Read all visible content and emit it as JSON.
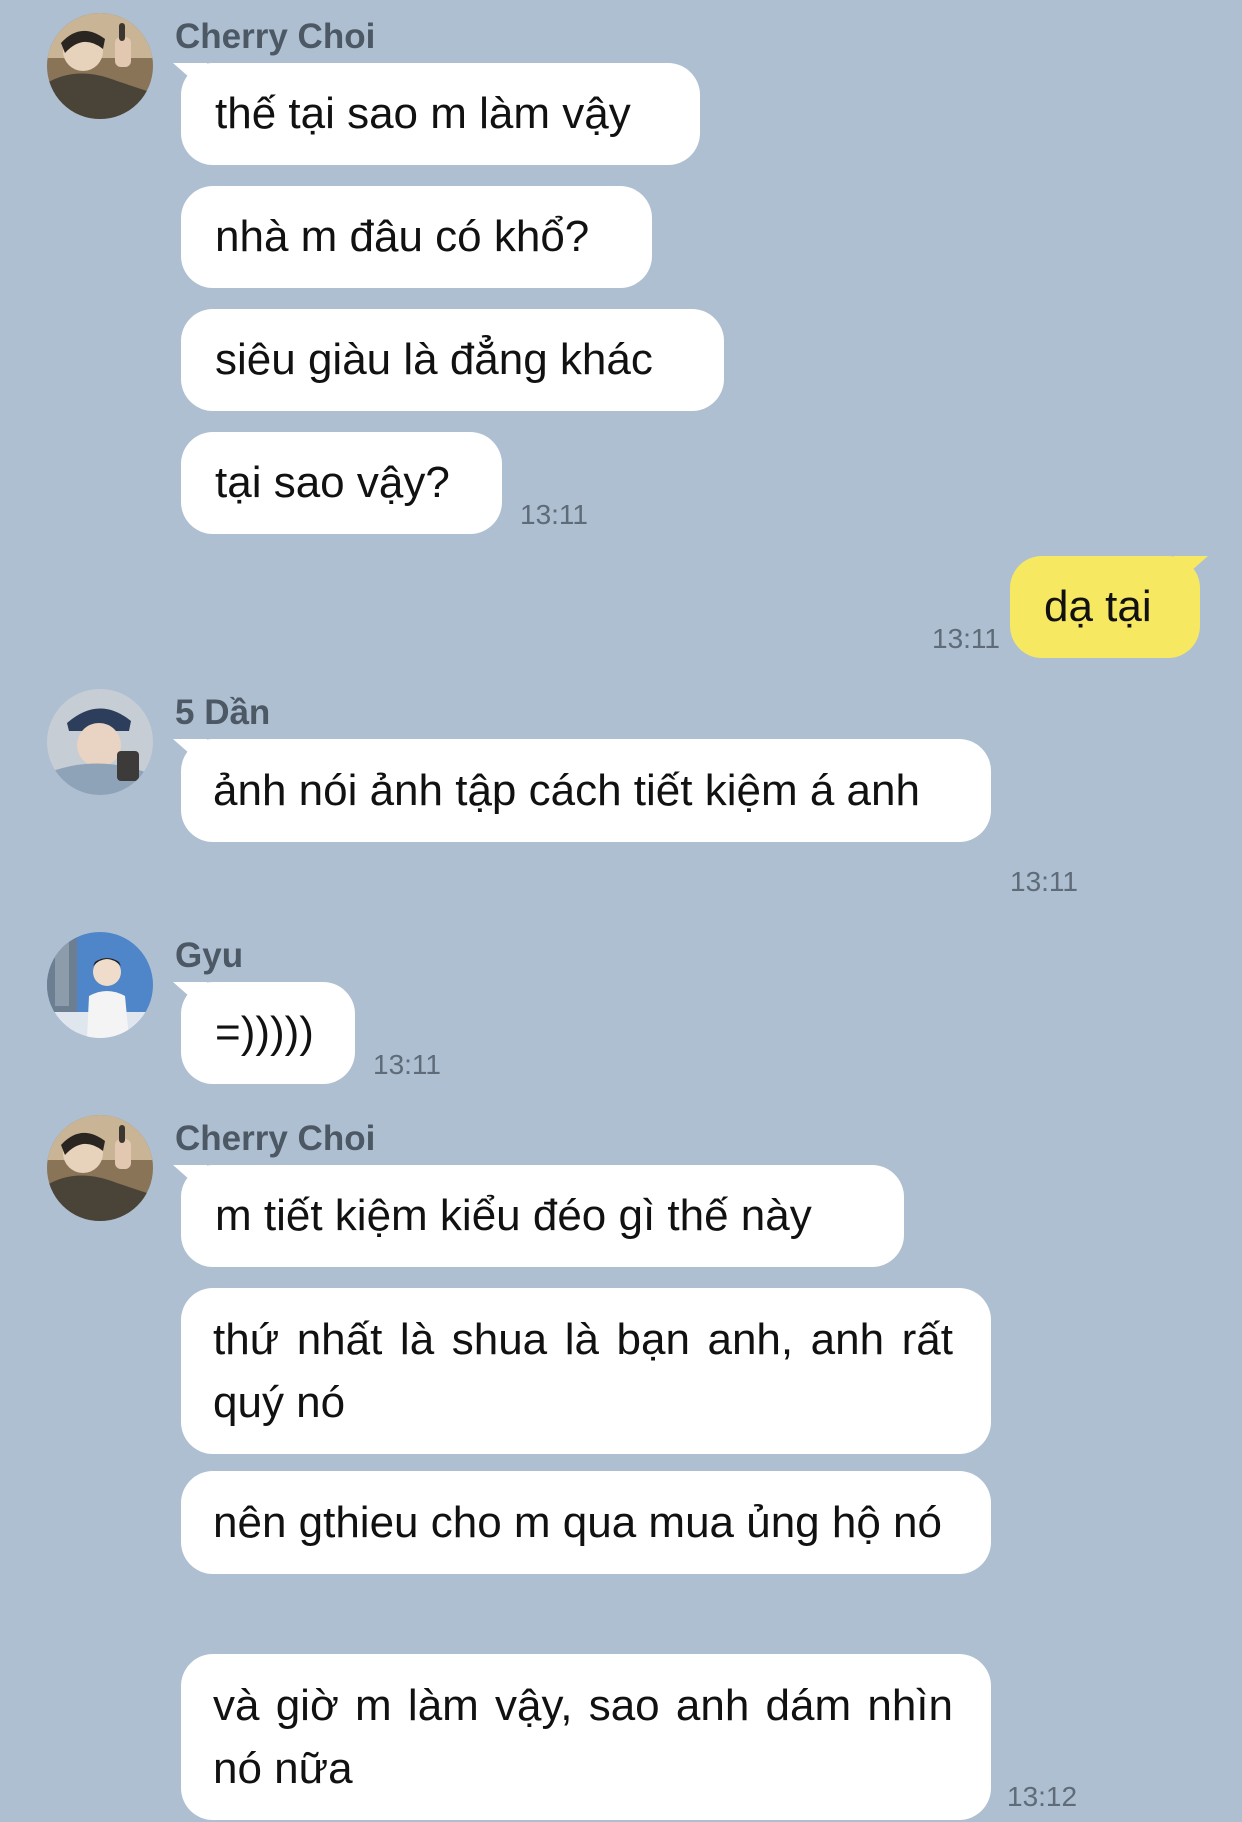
{
  "messages": [
    {
      "sender": "Cherry Choi",
      "lines": [
        "thế tại sao m làm vậy",
        "nhà m đâu có khổ?",
        "siêu giàu là đẳng khác",
        "tại sao vậy?"
      ],
      "time": "13:11"
    },
    {
      "sender": "me",
      "lines": [
        "dạ tại"
      ],
      "time": "13:11"
    },
    {
      "sender": "5 Dần",
      "lines": [
        "ảnh nói ảnh tập cách tiết kiệm á anh"
      ],
      "time": "13:11"
    },
    {
      "sender": "Gyu",
      "lines": [
        "=)))))"
      ],
      "time": "13:11"
    },
    {
      "sender": "Cherry Choi",
      "lines": [
        "m tiết kiệm kiểu đéo gì thế này",
        "thứ nhất là shua là bạn anh, anh rất quý nó",
        "nên gthieu cho m qua mua ủng hộ nó",
        "và giờ m làm vậy, sao anh dám nhìn nó nữa"
      ],
      "time": "13:12"
    }
  ],
  "colors": {
    "background": "#aebfd1",
    "incoming_bubble": "#ffffff",
    "outgoing_bubble": "#f7e861",
    "sender_name": "#4d5865",
    "timestamp": "#5f6b78"
  },
  "icons": [
    "avatar-cherry-choi",
    "avatar-5-dan",
    "avatar-gyu"
  ]
}
